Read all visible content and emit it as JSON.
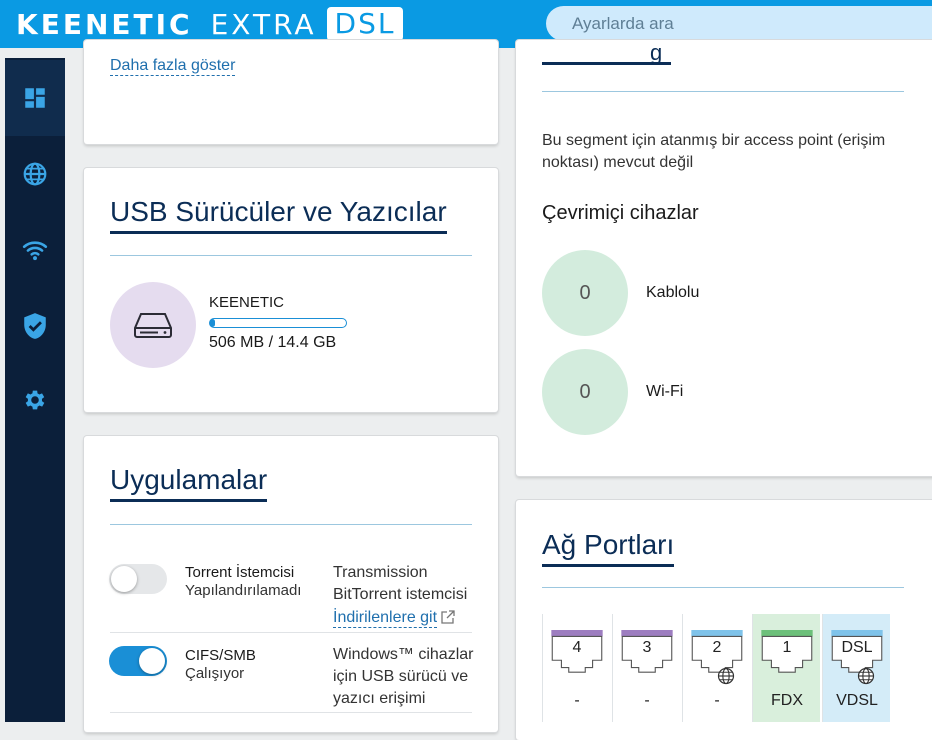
{
  "header": {
    "logo_keenetic": "KEENETIC",
    "logo_extra": "EXTRA",
    "logo_dsl": "DSL",
    "search_placeholder": "Ayarlarda ara"
  },
  "sidebar": {
    "items": [
      {
        "name": "dashboard",
        "icon": "dashboard-icon"
      },
      {
        "name": "internet",
        "icon": "globe-icon"
      },
      {
        "name": "wifi",
        "icon": "wifi-icon"
      },
      {
        "name": "security",
        "icon": "shield-check-icon"
      },
      {
        "name": "settings",
        "icon": "gear-icon"
      }
    ]
  },
  "top_left_card": {
    "show_more_link": "Daha fazla göster"
  },
  "usb_card": {
    "title": "USB Sürücüler ve Yazıcılar",
    "drive_name": "KEENETIC",
    "drive_usage": "506 MB / 14.4 GB",
    "usage_fraction": 0.034
  },
  "segment_card": {
    "no_ap_text_line1": "Bu segment için atanmış bir access point (erişim",
    "no_ap_text_line2": "noktası) mevcut değil",
    "online_devices_label": "Çevrimiçi cihazlar",
    "wired_count": "0",
    "wired_label": "Kablolu",
    "wifi_count": "0",
    "wifi_label": "Wi-Fi"
  },
  "apps_card": {
    "title": "Uygulamalar",
    "apps": [
      {
        "name": "Torrent İstemcisi",
        "status": "Yapılandırılamadı",
        "enabled": false,
        "desc_line1": "Transmission",
        "desc_line2": "BitTorrent istemcisi",
        "link": "İndirilenlere git"
      },
      {
        "name": "CIFS/SMB",
        "status": "Çalışıyor",
        "enabled": true,
        "desc_line1": "Windows™ cihazlar",
        "desc_line2": "için USB sürücü ve",
        "desc_line3": "yazıcı erişimi"
      }
    ]
  },
  "ports_card": {
    "title": "Ağ Portları",
    "ports": [
      {
        "label": "4",
        "sub": "-",
        "color": "#9d7dc0",
        "internet": false
      },
      {
        "label": "3",
        "sub": "-",
        "color": "#9d7dc0",
        "internet": false
      },
      {
        "label": "2",
        "sub": "-",
        "color": "#7fc3ea",
        "internet": true
      },
      {
        "label": "1",
        "sub": "FDX",
        "color": "#6cc07a",
        "internet": false
      },
      {
        "label": "DSL",
        "sub": "VDSL",
        "color": "#7fc3ea",
        "internet": true
      }
    ]
  },
  "colors": {
    "accent": "#0a9ae3",
    "sidebar": "#0b1f3a",
    "title": "#0b2d56",
    "toggle_on": "#1a8fd6",
    "online_circle": "#d3ecdd",
    "usb_circle": "#e5dcef"
  }
}
